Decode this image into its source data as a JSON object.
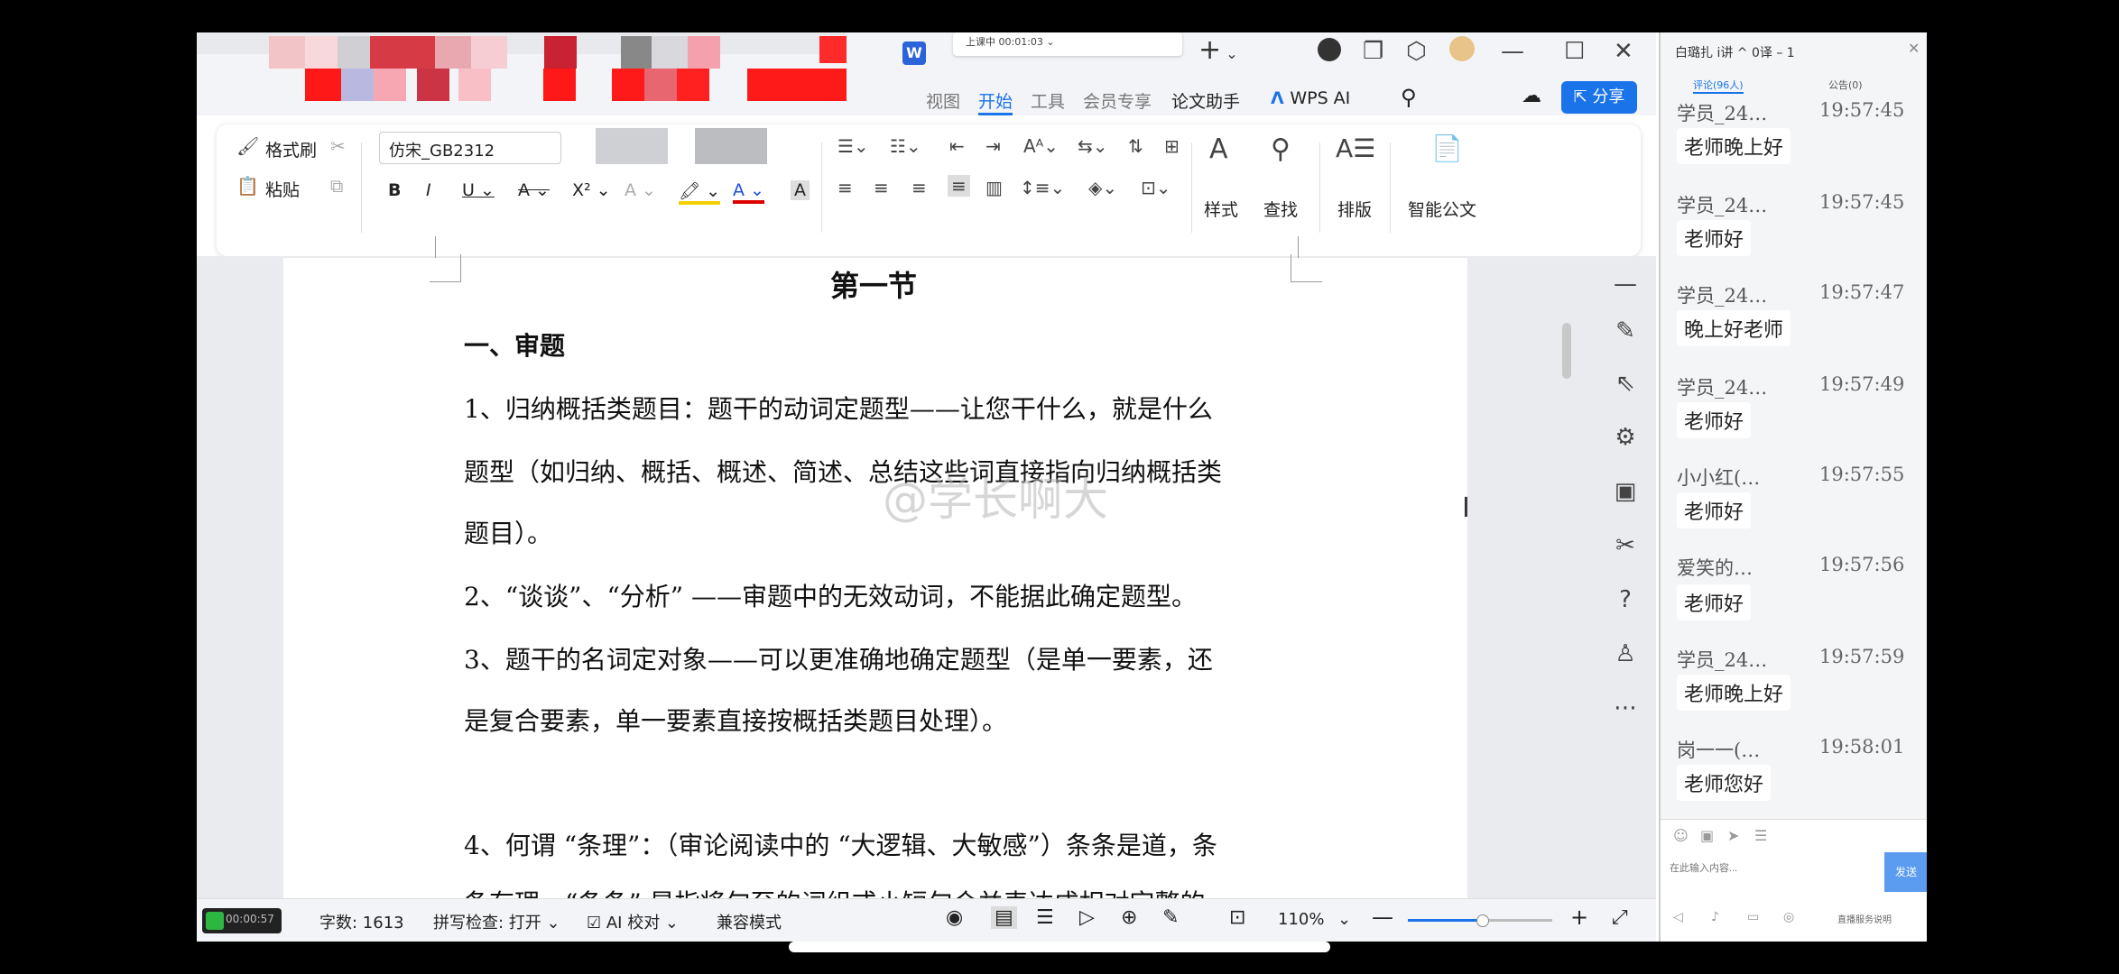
{
  "titlebar": {
    "recording_label": "上课中 00:01:03",
    "new_tab_icon": "plus-icon"
  },
  "ribbon_tabs": {
    "visible": [
      "视图",
      "开始",
      "工具",
      "会员专享",
      "论文助手",
      "WPS AI"
    ],
    "active": "开始",
    "share_label": "分享"
  },
  "ribbon": {
    "format_painter": "格式刷",
    "paste": "粘贴",
    "font_name": "仿宋_GB2312",
    "styles": "样式",
    "find": "查找",
    "layout": "排版",
    "smart_doc": "智能公文"
  },
  "document": {
    "heading": "第一节",
    "section": "一、审题",
    "lines": [
      "1、归纳概括类题目：题干的动词定题型——让您干什么，就是什么",
      "题型（如归纳、概括、概述、简述、总结这些词直接指向归纳概括类",
      "题目）。",
      "2、“谈谈”、“分析” ——审题中的无效动词，不能据此确定题型。",
      "3、题干的名词定对象——可以更准确地确定题型（是单一要素，还",
      "是复合要素，单一要素直接按概括类题目处理）。",
      "4、何谓 “条理”：（审论阅读中的 “大逻辑、大敏感”）条条是道，条",
      "条有理。“条条” 是指将句至的词组或小短句合并表达成相对完整的"
    ],
    "watermark": "@学长啊大"
  },
  "status": {
    "timer": "00:00:57",
    "word_count": "字数: 1613",
    "spell_check": "拼写检查: 打开",
    "ai_check": "AI 校对",
    "compat_mode": "兼容模式",
    "zoom": "110%"
  },
  "chat": {
    "title": "白璐扎 i讲 ^ 0译 – 1",
    "tab_comments": "评论(96人)",
    "tab_notice": "公告(0)",
    "messages": [
      {
        "name": "学员_24…",
        "time": "19:57:45",
        "text": "老师晚上好"
      },
      {
        "name": "学员_24…",
        "time": "19:57:45",
        "text": "老师好"
      },
      {
        "name": "学员_24…",
        "time": "19:57:47",
        "text": "晚上好老师"
      },
      {
        "name": "学员_24…",
        "time": "19:57:49",
        "text": "老师好"
      },
      {
        "name": "小小红(…",
        "time": "19:57:55",
        "text": "老师好"
      },
      {
        "name": "爱笑的…",
        "time": "19:57:56",
        "text": "老师好"
      },
      {
        "name": "学员_24…",
        "time": "19:57:59",
        "text": "老师晚上好"
      },
      {
        "name": "岗一一(…",
        "time": "19:58:01",
        "text": "老师您好"
      }
    ],
    "input_placeholder": "在此输入内容...",
    "send_label": "发送",
    "footer_link": "直播服务说明"
  },
  "colors": {
    "accent_blue": "#1a73e8",
    "timer_green": "#2db742"
  }
}
